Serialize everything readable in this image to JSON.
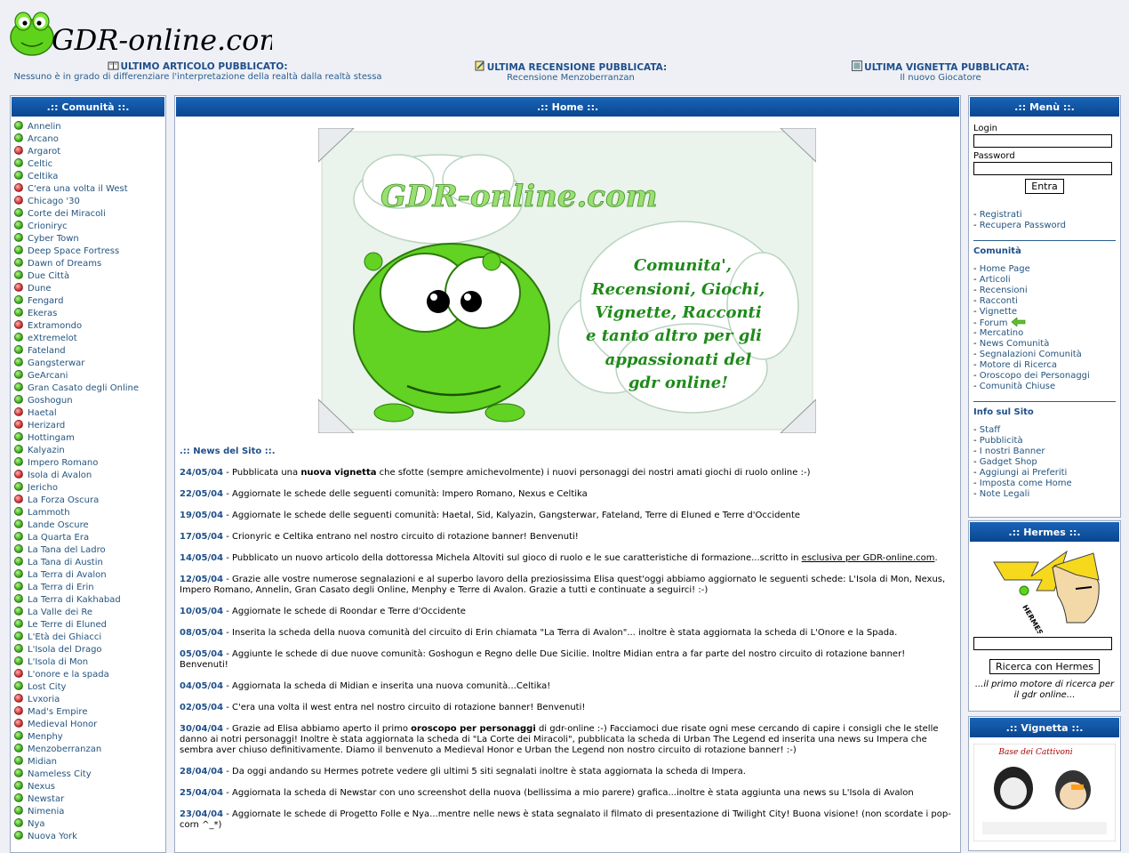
{
  "header": {
    "logo_text": "GDR-online.com",
    "articolo": {
      "title": "ULTIMO ARTICOLO PUBBLICATO:",
      "sub": "Nessuno è in grado di differenziare l'interpretazione della realtà dalla realtà stessa",
      "icon": "book-icon"
    },
    "recensione": {
      "title": "ULTIMA RECENSIONE PUBBLICATA:",
      "sub": "Recensione Menzoberranzan",
      "icon": "pencil-note-icon"
    },
    "vignetta": {
      "title": "ULTIMA VIGNETTA PUBBLICATA:",
      "sub": "Il nuovo Giocatore",
      "icon": "picture-icon"
    }
  },
  "left": {
    "title": ".:: Comunità ::.",
    "items": [
      {
        "name": "Annelin",
        "status": "green"
      },
      {
        "name": "Arcano",
        "status": "green"
      },
      {
        "name": "Argarot",
        "status": "red"
      },
      {
        "name": "Celtic",
        "status": "green"
      },
      {
        "name": "Celtika",
        "status": "green"
      },
      {
        "name": "C'era una volta il West",
        "status": "red"
      },
      {
        "name": "Chicago '30",
        "status": "red"
      },
      {
        "name": "Corte dei Miracoli",
        "status": "green"
      },
      {
        "name": "Crioniryc",
        "status": "green"
      },
      {
        "name": "Cyber Town",
        "status": "green"
      },
      {
        "name": "Deep Space Fortress",
        "status": "green"
      },
      {
        "name": "Dawn of Dreams",
        "status": "green"
      },
      {
        "name": "Due Città",
        "status": "green"
      },
      {
        "name": "Dune",
        "status": "red"
      },
      {
        "name": "Fengard",
        "status": "green"
      },
      {
        "name": "Ekeras",
        "status": "green"
      },
      {
        "name": "Extramondo",
        "status": "red"
      },
      {
        "name": "eXtremelot",
        "status": "green"
      },
      {
        "name": "Fateland",
        "status": "green"
      },
      {
        "name": "Gangsterwar",
        "status": "green"
      },
      {
        "name": "GeArcani",
        "status": "green"
      },
      {
        "name": "Gran Casato degli Online",
        "status": "green"
      },
      {
        "name": "Goshogun",
        "status": "green"
      },
      {
        "name": "Haetal",
        "status": "red"
      },
      {
        "name": "Herizard",
        "status": "red"
      },
      {
        "name": "Hottingam",
        "status": "green"
      },
      {
        "name": "Kalyazin",
        "status": "green"
      },
      {
        "name": "Impero Romano",
        "status": "green"
      },
      {
        "name": "Isola di Avalon",
        "status": "red"
      },
      {
        "name": "Jericho",
        "status": "green"
      },
      {
        "name": "La Forza Oscura",
        "status": "red"
      },
      {
        "name": "Lammoth",
        "status": "green"
      },
      {
        "name": "Lande Oscure",
        "status": "green"
      },
      {
        "name": "La Quarta Era",
        "status": "green"
      },
      {
        "name": "La Tana del Ladro",
        "status": "green"
      },
      {
        "name": "La Tana di Austin",
        "status": "green"
      },
      {
        "name": "La Terra di Avalon",
        "status": "green"
      },
      {
        "name": "La Terra di Erin",
        "status": "green"
      },
      {
        "name": "La Terra di Kakhabad",
        "status": "green"
      },
      {
        "name": "La Valle dei Re",
        "status": "green"
      },
      {
        "name": "Le Terre di Eluned",
        "status": "green"
      },
      {
        "name": "L'Età dei Ghiacci",
        "status": "green"
      },
      {
        "name": "L'Isola del Drago",
        "status": "green"
      },
      {
        "name": "L'Isola di Mon",
        "status": "green"
      },
      {
        "name": "L'onore e la spada",
        "status": "red"
      },
      {
        "name": "Lost City",
        "status": "green"
      },
      {
        "name": "Lvxoria",
        "status": "red"
      },
      {
        "name": "Mad's Empire",
        "status": "red"
      },
      {
        "name": "Medieval Honor",
        "status": "red"
      },
      {
        "name": "Menphy",
        "status": "green"
      },
      {
        "name": "Menzoberranzan",
        "status": "green"
      },
      {
        "name": "Midian",
        "status": "green"
      },
      {
        "name": "Nameless City",
        "status": "green"
      },
      {
        "name": "Nexus",
        "status": "green"
      },
      {
        "name": "Newstar",
        "status": "green"
      },
      {
        "name": "Nimenia",
        "status": "green"
      },
      {
        "name": "Nya",
        "status": "green"
      },
      {
        "name": "Nuova York",
        "status": "green"
      }
    ]
  },
  "center": {
    "title": ".:: Home ::.",
    "banner": {
      "logo": "GDR-online.com",
      "lines": [
        "Comunita',",
        "Recensioni, Giochi,",
        "Vignette, Racconti",
        "e tanto altro per gli",
        "appassionati del",
        "gdr online!"
      ]
    },
    "news_title": ".:: News del Sito ::.",
    "news": [
      {
        "date": "24/05/04",
        "pre": "Pubblicata una ",
        "bold": "nuova vignetta",
        "post": " che sfotte (sempre amichevolmente) i nuovi personaggi dei nostri amati giochi di ruolo online :-)"
      },
      {
        "date": "22/05/04",
        "text": "Aggiornate le schede delle seguenti comunità: Impero Romano, Nexus e Celtika"
      },
      {
        "date": "19/05/04",
        "text": "Aggiornate le schede delle seguenti comunità: Haetal, Sid, Kalyazin, Gangsterwar, Fateland, Terre di Eluned e Terre d'Occidente"
      },
      {
        "date": "17/05/04",
        "text": "Crionyric e Celtika entrano nel nostro circuito di rotazione banner! Benvenuti!"
      },
      {
        "date": "14/05/04",
        "pre": "Pubblicato un nuovo articolo della dottoressa Michela Altoviti sul gioco di ruolo e le sue caratteristiche di formazione...scritto in ",
        "link": "esclusiva per GDR-online.com",
        "post": "."
      },
      {
        "date": "12/05/04",
        "text": "Grazie alle vostre numerose segnalazioni e al superbo lavoro della preziosissima Elisa quest'oggi abbiamo aggiornato le seguenti schede: L'Isola di Mon, Nexus, Impero Romano, Annelin, Gran Casato degli Online, Menphy e Terre di Avalon. Grazie a tutti e continuate a seguirci! :-)"
      },
      {
        "date": "10/05/04",
        "text": "Aggiornate le schede di Roondar e Terre d'Occidente"
      },
      {
        "date": "08/05/04",
        "text": "Inserita la scheda della nuova comunità del circuito di Erin chiamata \"La Terra di Avalon\"... inoltre è stata aggiornata la scheda di L'Onore e la Spada."
      },
      {
        "date": "05/05/04",
        "text": "Aggiunte le schede di due nuove comunità: Goshogun e Regno delle Due Sicilie. Inoltre Midian entra a far parte del nostro circuito di rotazione banner! Benvenuti!"
      },
      {
        "date": "04/05/04",
        "text": "Aggiornata la scheda di Midian e inserita una nuova comunità...Celtika!"
      },
      {
        "date": "02/05/04",
        "text": "C'era una volta il west entra nel nostro circuito di rotazione banner! Benvenuti!"
      },
      {
        "date": "30/04/04",
        "pre": "Grazie ad Elisa abbiamo aperto il primo ",
        "bold": "oroscopo per personaggi",
        "post": " di gdr-online :-) Facciamoci due risate ogni mese cercando di capire i consigli che le stelle danno ai notri personaggi! Inoltre è stata aggiornata la scheda di \"La Corte dei Miracoli\", pubblicata la scheda di Urban The Legend ed inserita una news su Impera che sembra aver chiuso definitivamente. Diamo il benvenuto a Medieval Honor e Urban the Legend non nostro circuito di rotazione banner! :-)"
      },
      {
        "date": "28/04/04",
        "text": "Da oggi andando su Hermes potrete vedere gli ultimi 5 siti segnalati inoltre è stata aggiornata la scheda di Impera."
      },
      {
        "date": "25/04/04",
        "text": "Aggiornata la scheda di Newstar con uno screenshot della nuova (bellissima a mio parere) grafica...inoltre è stata aggiunta una news su L'Isola di Avalon"
      },
      {
        "date": "23/04/04",
        "text": "Aggiornate le schede di Progetto Folle e Nya...mentre nelle news è stata segnalato il filmato di presentazione di Twilight City! Buona visione! (non scordate i pop-corn ^_*)"
      }
    ]
  },
  "right": {
    "title": ".:: Menù ::.",
    "login_label": "Login",
    "password_label": "Password",
    "login_value": "",
    "password_value": "",
    "submit": "Entra",
    "account_links": [
      "Registrati",
      "Recupera Password"
    ],
    "comunita_title": "Comunità",
    "comunita_links": [
      "Home Page",
      "Articoli",
      "Recensioni",
      "Racconti",
      "Vignette",
      "Forum",
      "Mercatino",
      "News Comunità",
      "Segnalazioni Comunità",
      "Motore di Ricerca",
      "Oroscopo dei Personaggi",
      "Comunità Chiuse"
    ],
    "info_title": "Info sul Sito",
    "info_links": [
      "Staff",
      "Pubblicità",
      "I nostri Banner",
      "Gadget Shop",
      "Aggiungi ai Preferiti",
      "Imposta come Home",
      "Note Legali"
    ]
  },
  "hermes": {
    "title": ".:: Hermes ::.",
    "logo_text": "HERMES",
    "search_value": "",
    "button": "Ricerca con Hermes",
    "tagline": "...il primo motore di ricerca per il gdr online..."
  },
  "vignetta_box": {
    "title": ".:: Vignetta ::.",
    "comic_title": "Base dei Cattivoni"
  },
  "colors": {
    "header_blue": "#0a468f",
    "link": "#25557f",
    "frog_green": "#5fd31c"
  }
}
